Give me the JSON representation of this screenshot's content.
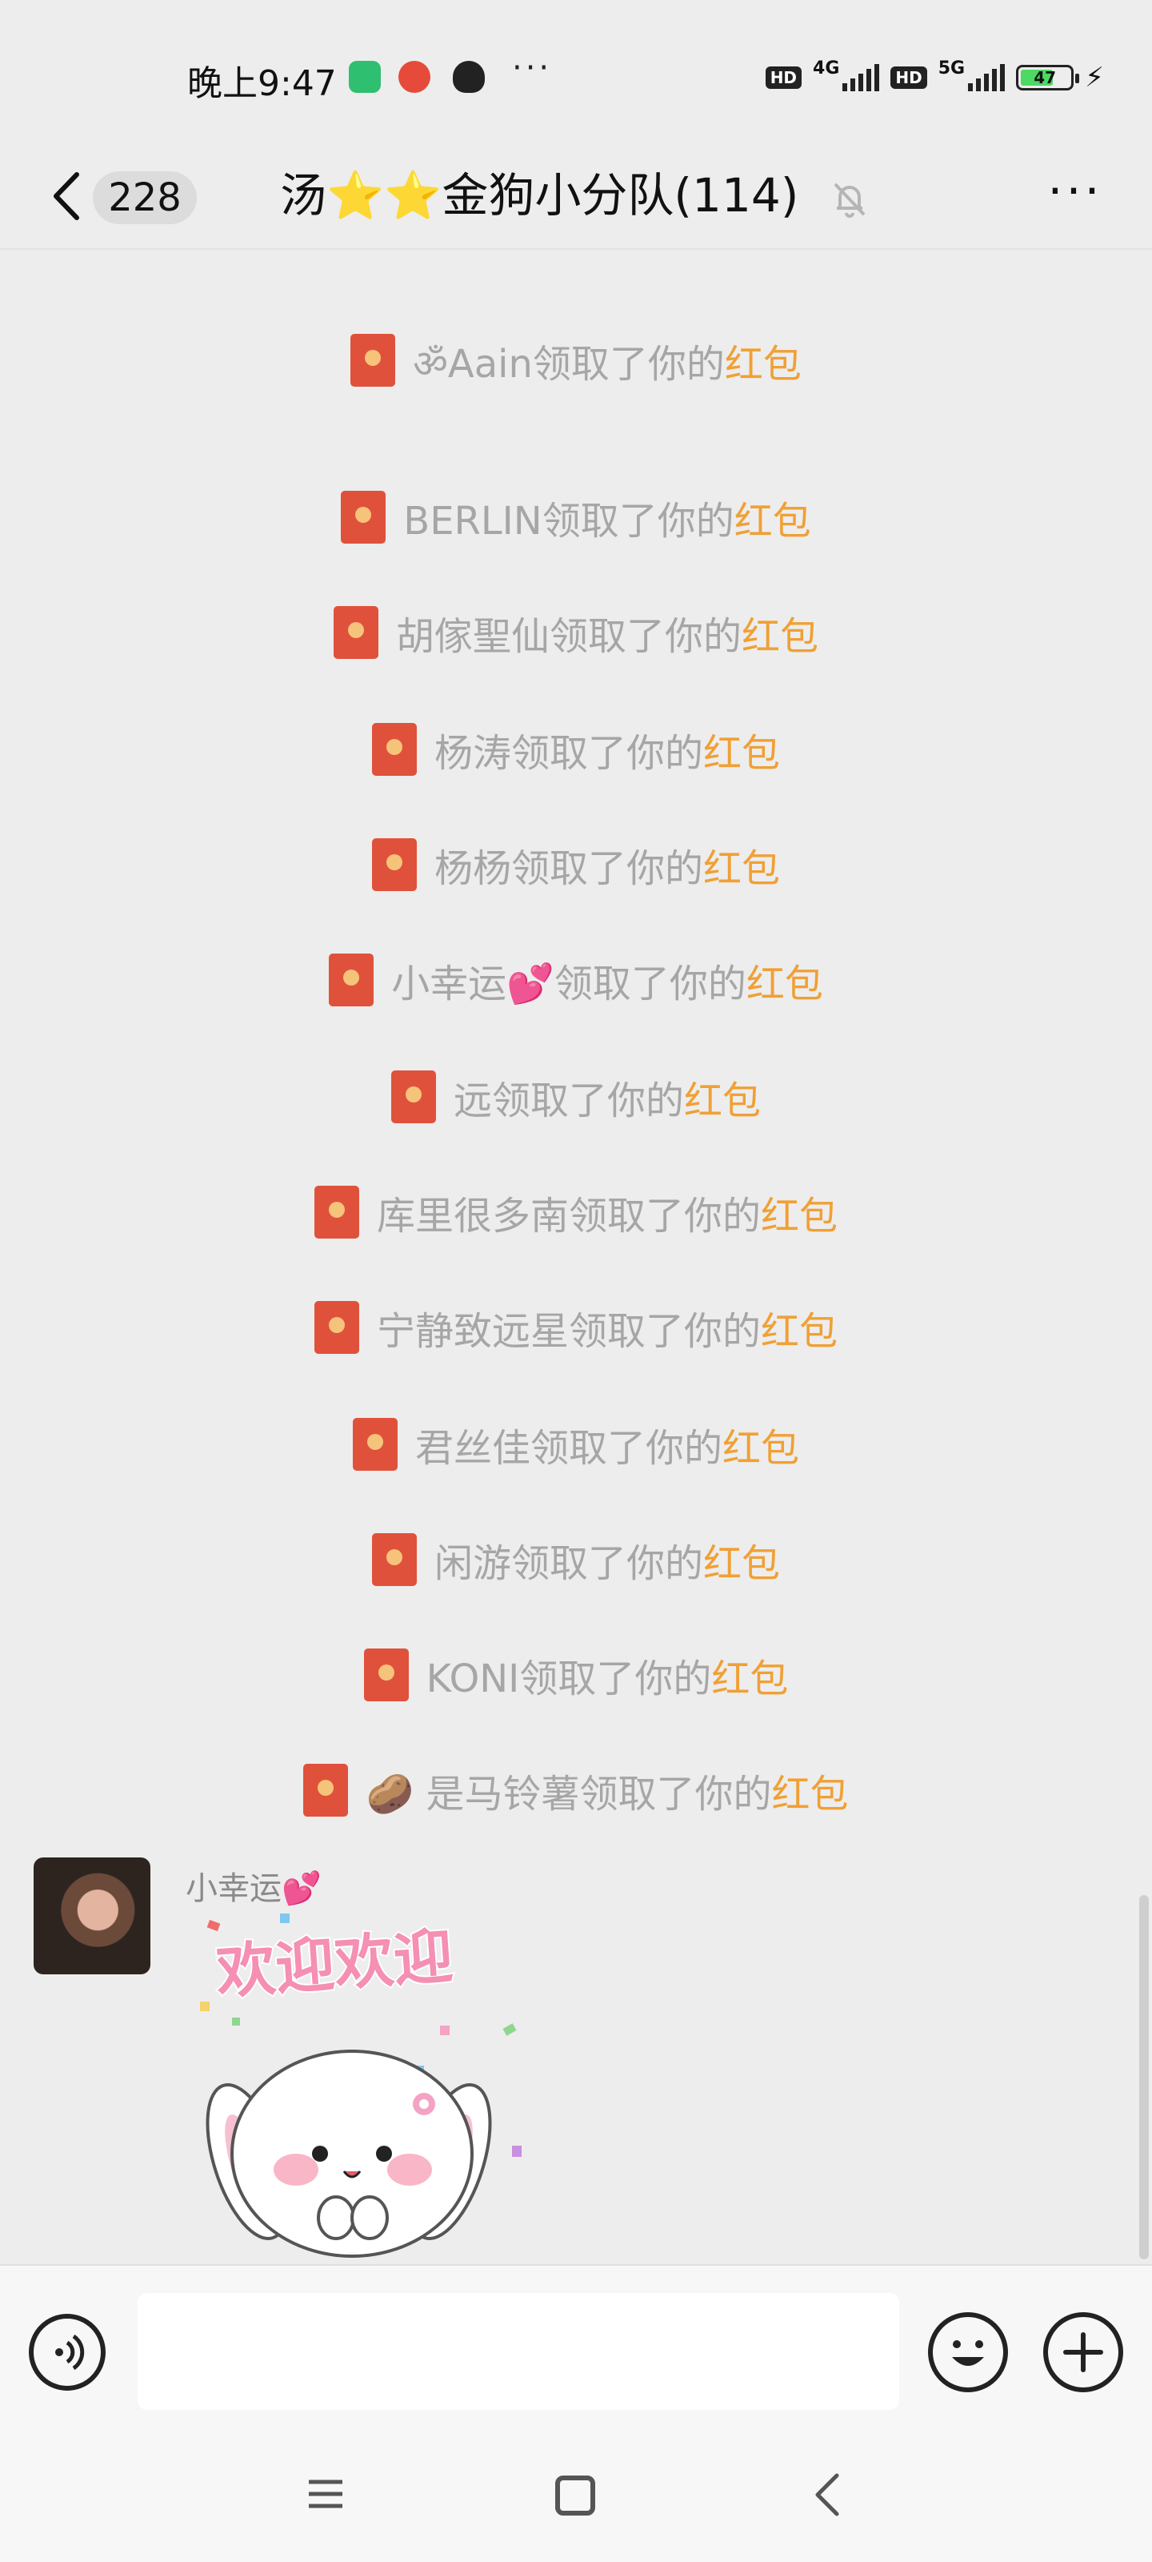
{
  "status_bar": {
    "time": "晚上9:47",
    "more_indicator": "···",
    "hd1": "HD",
    "net1": "4G",
    "hd2": "HD",
    "net2": "5G",
    "battery_level": "47",
    "charging_icon": "⚡"
  },
  "header": {
    "back_icon": "chevron-left-icon",
    "unread_count": "228",
    "title": "汤⭐⭐金狗小分队(114)",
    "mute_icon": "bell-slash-icon",
    "more_label": "···"
  },
  "system_messages": [
    {
      "who": "ॐAain领取了你的",
      "link": "红包"
    },
    {
      "who": "BERLIN领取了你的",
      "link": "红包"
    },
    {
      "who": "胡傢聖仙领取了你的",
      "link": "红包"
    },
    {
      "who": "杨涛领取了你的",
      "link": "红包"
    },
    {
      "who": "杨杨领取了你的",
      "link": "红包"
    },
    {
      "who": "小幸运💕领取了你的",
      "link": "红包"
    },
    {
      "who": "远领取了你的",
      "link": "红包"
    },
    {
      "who": "库里很多南领取了你的",
      "link": "红包"
    },
    {
      "who": "宁静致远星领取了你的",
      "link": "红包"
    },
    {
      "who": "君丝佳领取了你的",
      "link": "红包"
    },
    {
      "who": "闲游领取了你的",
      "link": "红包"
    },
    {
      "who": "KONI领取了你的",
      "link": "红包"
    },
    {
      "who": "🥔 是马铃薯领取了你的",
      "link": "红包"
    }
  ],
  "message": {
    "sender": "小幸运💕",
    "sticker_text": "欢迎欢迎"
  },
  "colors": {
    "red_packet": "#e0513b",
    "link_orange": "#f0a035",
    "system_text": "#a6a6a6",
    "background": "#ededed"
  },
  "input_bar": {
    "voice_icon": "voice-icon",
    "emoji_icon": "smiley-icon",
    "plus_icon": "plus-icon"
  },
  "nav_bar": {
    "menu_icon": "menu-icon",
    "home_icon": "home-square-icon",
    "back_icon": "back-icon"
  }
}
